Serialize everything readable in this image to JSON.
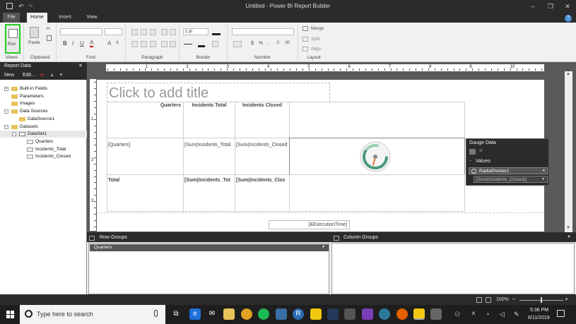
{
  "app": {
    "title": "Untitled - Power BI Report Builder"
  },
  "tabs": [
    "File",
    "Home",
    "Insert",
    "View"
  ],
  "ribbon": {
    "views": {
      "group": "Views",
      "run_label": "Run"
    },
    "clipboard": {
      "group": "Clipboard",
      "paste": "Paste"
    },
    "font": {
      "group": "Font"
    },
    "paragraph": {
      "group": "Paragraph"
    },
    "border": {
      "group": "Border",
      "width": "1 pt"
    },
    "number": {
      "group": "Number"
    },
    "layout": {
      "group": "Layout",
      "merge": "Merge",
      "split": "Split",
      "align": "Align"
    }
  },
  "report_data": {
    "title": "Report Data",
    "new_label": "New",
    "edit_label": "Edit...",
    "tree": [
      {
        "label": "Built-in Fields",
        "level": 0,
        "toggle": "+",
        "icon": "folder"
      },
      {
        "label": "Parameters",
        "level": 0,
        "toggle": "",
        "icon": "folder"
      },
      {
        "label": "Images",
        "level": 0,
        "toggle": "",
        "icon": "folder"
      },
      {
        "label": "Data Sources",
        "level": 0,
        "toggle": "−",
        "icon": "folder"
      },
      {
        "label": "DataSource1",
        "level": 1,
        "toggle": "",
        "icon": "folder"
      },
      {
        "label": "Datasets",
        "level": 0,
        "toggle": "−",
        "icon": "folder"
      },
      {
        "label": "DataSet1",
        "level": 1,
        "toggle": "−",
        "icon": "dataset"
      },
      {
        "label": "Quarters",
        "level": 2,
        "toggle": "",
        "icon": "field"
      },
      {
        "label": "Incidents_Total",
        "level": 2,
        "toggle": "",
        "icon": "field"
      },
      {
        "label": "Incidents_Closed",
        "level": 2,
        "toggle": "",
        "icon": "field"
      }
    ]
  },
  "ruler": {
    "h_labels": [
      "1",
      "2",
      "3",
      "4",
      "5",
      "6",
      "7",
      "8",
      "9",
      "10"
    ],
    "v_labels": [
      "1",
      "2",
      "3"
    ]
  },
  "report": {
    "title_placeholder": "Click to add title",
    "headers": [
      "Quarters",
      "Incidents Total",
      "Incidents Closed"
    ],
    "detail": [
      "[Quarters]",
      "[Sum(Incidents_Total",
      "[Sum(Incidents_Closed"
    ],
    "total": [
      "Total",
      "[Sum(Incidents_Tot",
      "[Sum(Incidents_Clos"
    ],
    "footer": "[&ExecutionTime]"
  },
  "gauge_data": {
    "title": "Gauge Data",
    "values_label": "Values",
    "pointer": "RadialPointer1",
    "value": "[Sum(Incidents_Closed)]"
  },
  "groups": {
    "row_title": "Row Groups",
    "row_item": "Quarters",
    "column_title": "Column Groups"
  },
  "status": {
    "zoom": "100%"
  },
  "taskbar": {
    "search_placeholder": "Type here to search",
    "time": "5:36 PM",
    "date": "6/11/2019"
  }
}
